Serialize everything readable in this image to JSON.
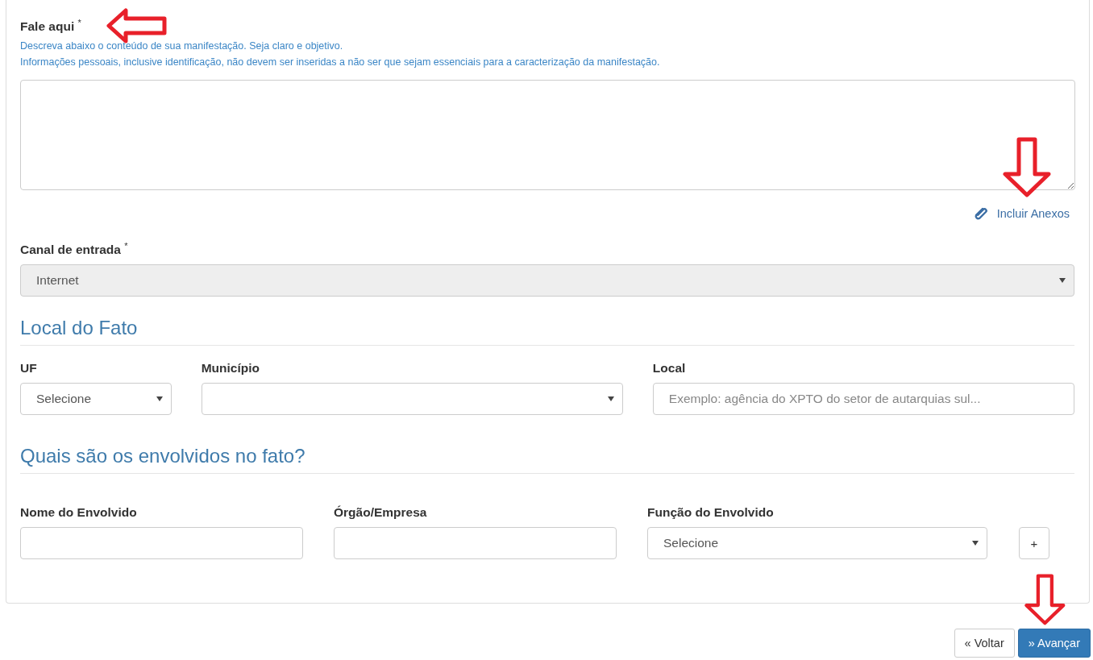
{
  "description": {
    "label": "Fale aqui",
    "required_mark": "*",
    "help": [
      "Descreva abaixo o conteúdo de sua manifestação. Seja claro e objetivo.",
      "Informações pessoais, inclusive identificação, não devem ser inseridas a não ser que sejam essenciais para a caracterização da manifestação."
    ]
  },
  "attachment_link": "Incluir Anexos",
  "entry_channel": {
    "label": "Canal de entrada",
    "required_mark": "*",
    "value": "Internet",
    "disabled": true
  },
  "location": {
    "heading": "Local do Fato",
    "fields": [
      {
        "kind": "select",
        "label": "UF",
        "value": "Selecione"
      },
      {
        "kind": "select",
        "label": "Município"
      },
      {
        "kind": "input",
        "label": "Local",
        "placeholder": "Exemplo: agência do XPTO do setor de autarquias sul..."
      }
    ]
  },
  "involved": {
    "heading": "Quais são os envolvidos no fato?",
    "fields": [
      {
        "kind": "input",
        "label": "Nome do Envolvido"
      },
      {
        "kind": "input",
        "label": "Órgão/Empresa"
      },
      {
        "kind": "select",
        "label": "Função do Envolvido",
        "value": "Selecione"
      }
    ],
    "add_button": "+"
  },
  "buttons": [
    {
      "label": "« Voltar",
      "primary": false
    },
    {
      "label": "» Avançar",
      "primary": true
    }
  ],
  "annotations": [
    {
      "kind": "arrow-left"
    },
    {
      "kind": "arrow-down"
    },
    {
      "kind": "arrow-down"
    }
  ]
}
